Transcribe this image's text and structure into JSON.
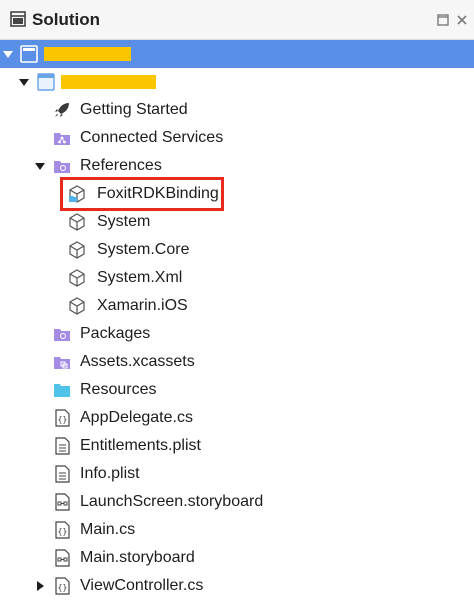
{
  "header": {
    "title": "Solution"
  },
  "colors": {
    "selection": "#5a8fe7",
    "redaction": "#f9c600",
    "folder_purple": "#a48be3",
    "folder_blue": "#4fc3ea",
    "highlight": "#e8291c"
  },
  "tree": {
    "getting_started": "Getting Started",
    "connected_services": "Connected Services",
    "references": "References",
    "refs": [
      "FoxitRDKBinding",
      "System",
      "System.Core",
      "System.Xml",
      "Xamarin.iOS"
    ],
    "packages": "Packages",
    "assets": "Assets.xcassets",
    "resources": "Resources",
    "files": [
      "AppDelegate.cs",
      "Entitlements.plist",
      "Info.plist",
      "LaunchScreen.storyboard",
      "Main.cs",
      "Main.storyboard",
      "ViewController.cs"
    ]
  }
}
